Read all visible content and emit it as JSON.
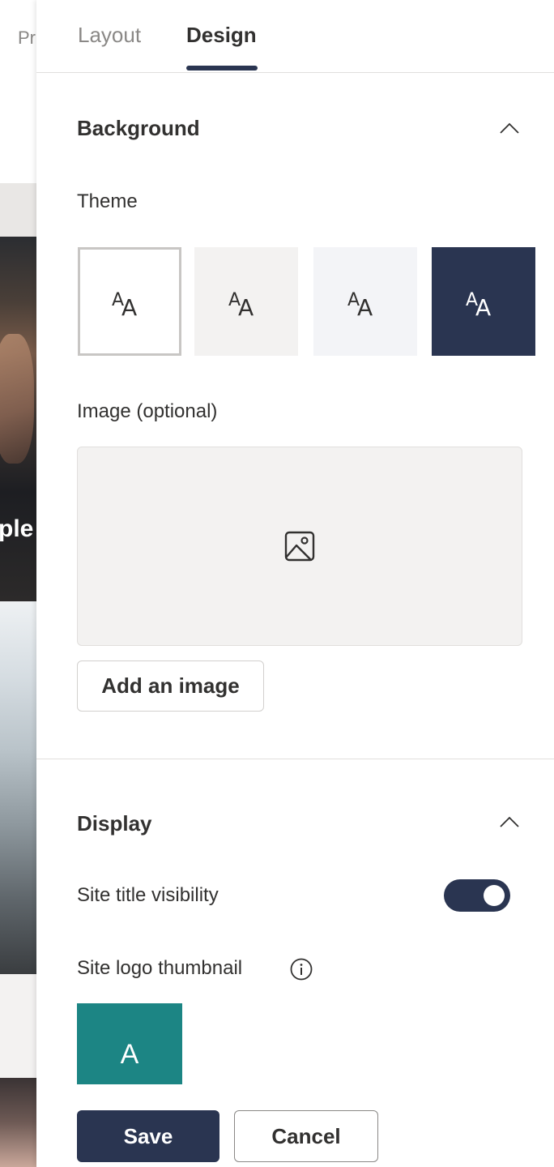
{
  "background_page": {
    "tab_fragment": "Pr",
    "title_fragment": "ple"
  },
  "tabs": [
    {
      "label": "Layout",
      "selected": false
    },
    {
      "label": "Design",
      "selected": true
    }
  ],
  "background_section": {
    "title": "Background",
    "expanded": true,
    "theme_label": "Theme",
    "themes": [
      {
        "name": "white",
        "color": "#ffffff",
        "selected": true,
        "icon": "font-size-icon"
      },
      {
        "name": "light gray",
        "color": "#f3f2f1",
        "selected": false,
        "icon": "font-size-icon"
      },
      {
        "name": "light blue-gray",
        "color": "#f3f4f7",
        "selected": false,
        "icon": "font-size-icon"
      },
      {
        "name": "dark navy",
        "color": "#2a3551",
        "selected": false,
        "icon": "font-size-icon"
      }
    ],
    "image_label": "Image (optional)",
    "image_placeholder_icon": "image-icon",
    "add_image_label": "Add an image"
  },
  "display_section": {
    "title": "Display",
    "expanded": true,
    "site_title_visibility_label": "Site title visibility",
    "site_title_visibility_on": true,
    "site_logo_label": "Site logo thumbnail",
    "site_logo_info_icon": "info-icon",
    "site_logo_letter": "A",
    "site_logo_color": "#1c8584"
  },
  "footer": {
    "save_label": "Save",
    "cancel_label": "Cancel"
  },
  "colors": {
    "accent": "#2a3551",
    "text": "#323130",
    "muted": "#8a8886"
  }
}
